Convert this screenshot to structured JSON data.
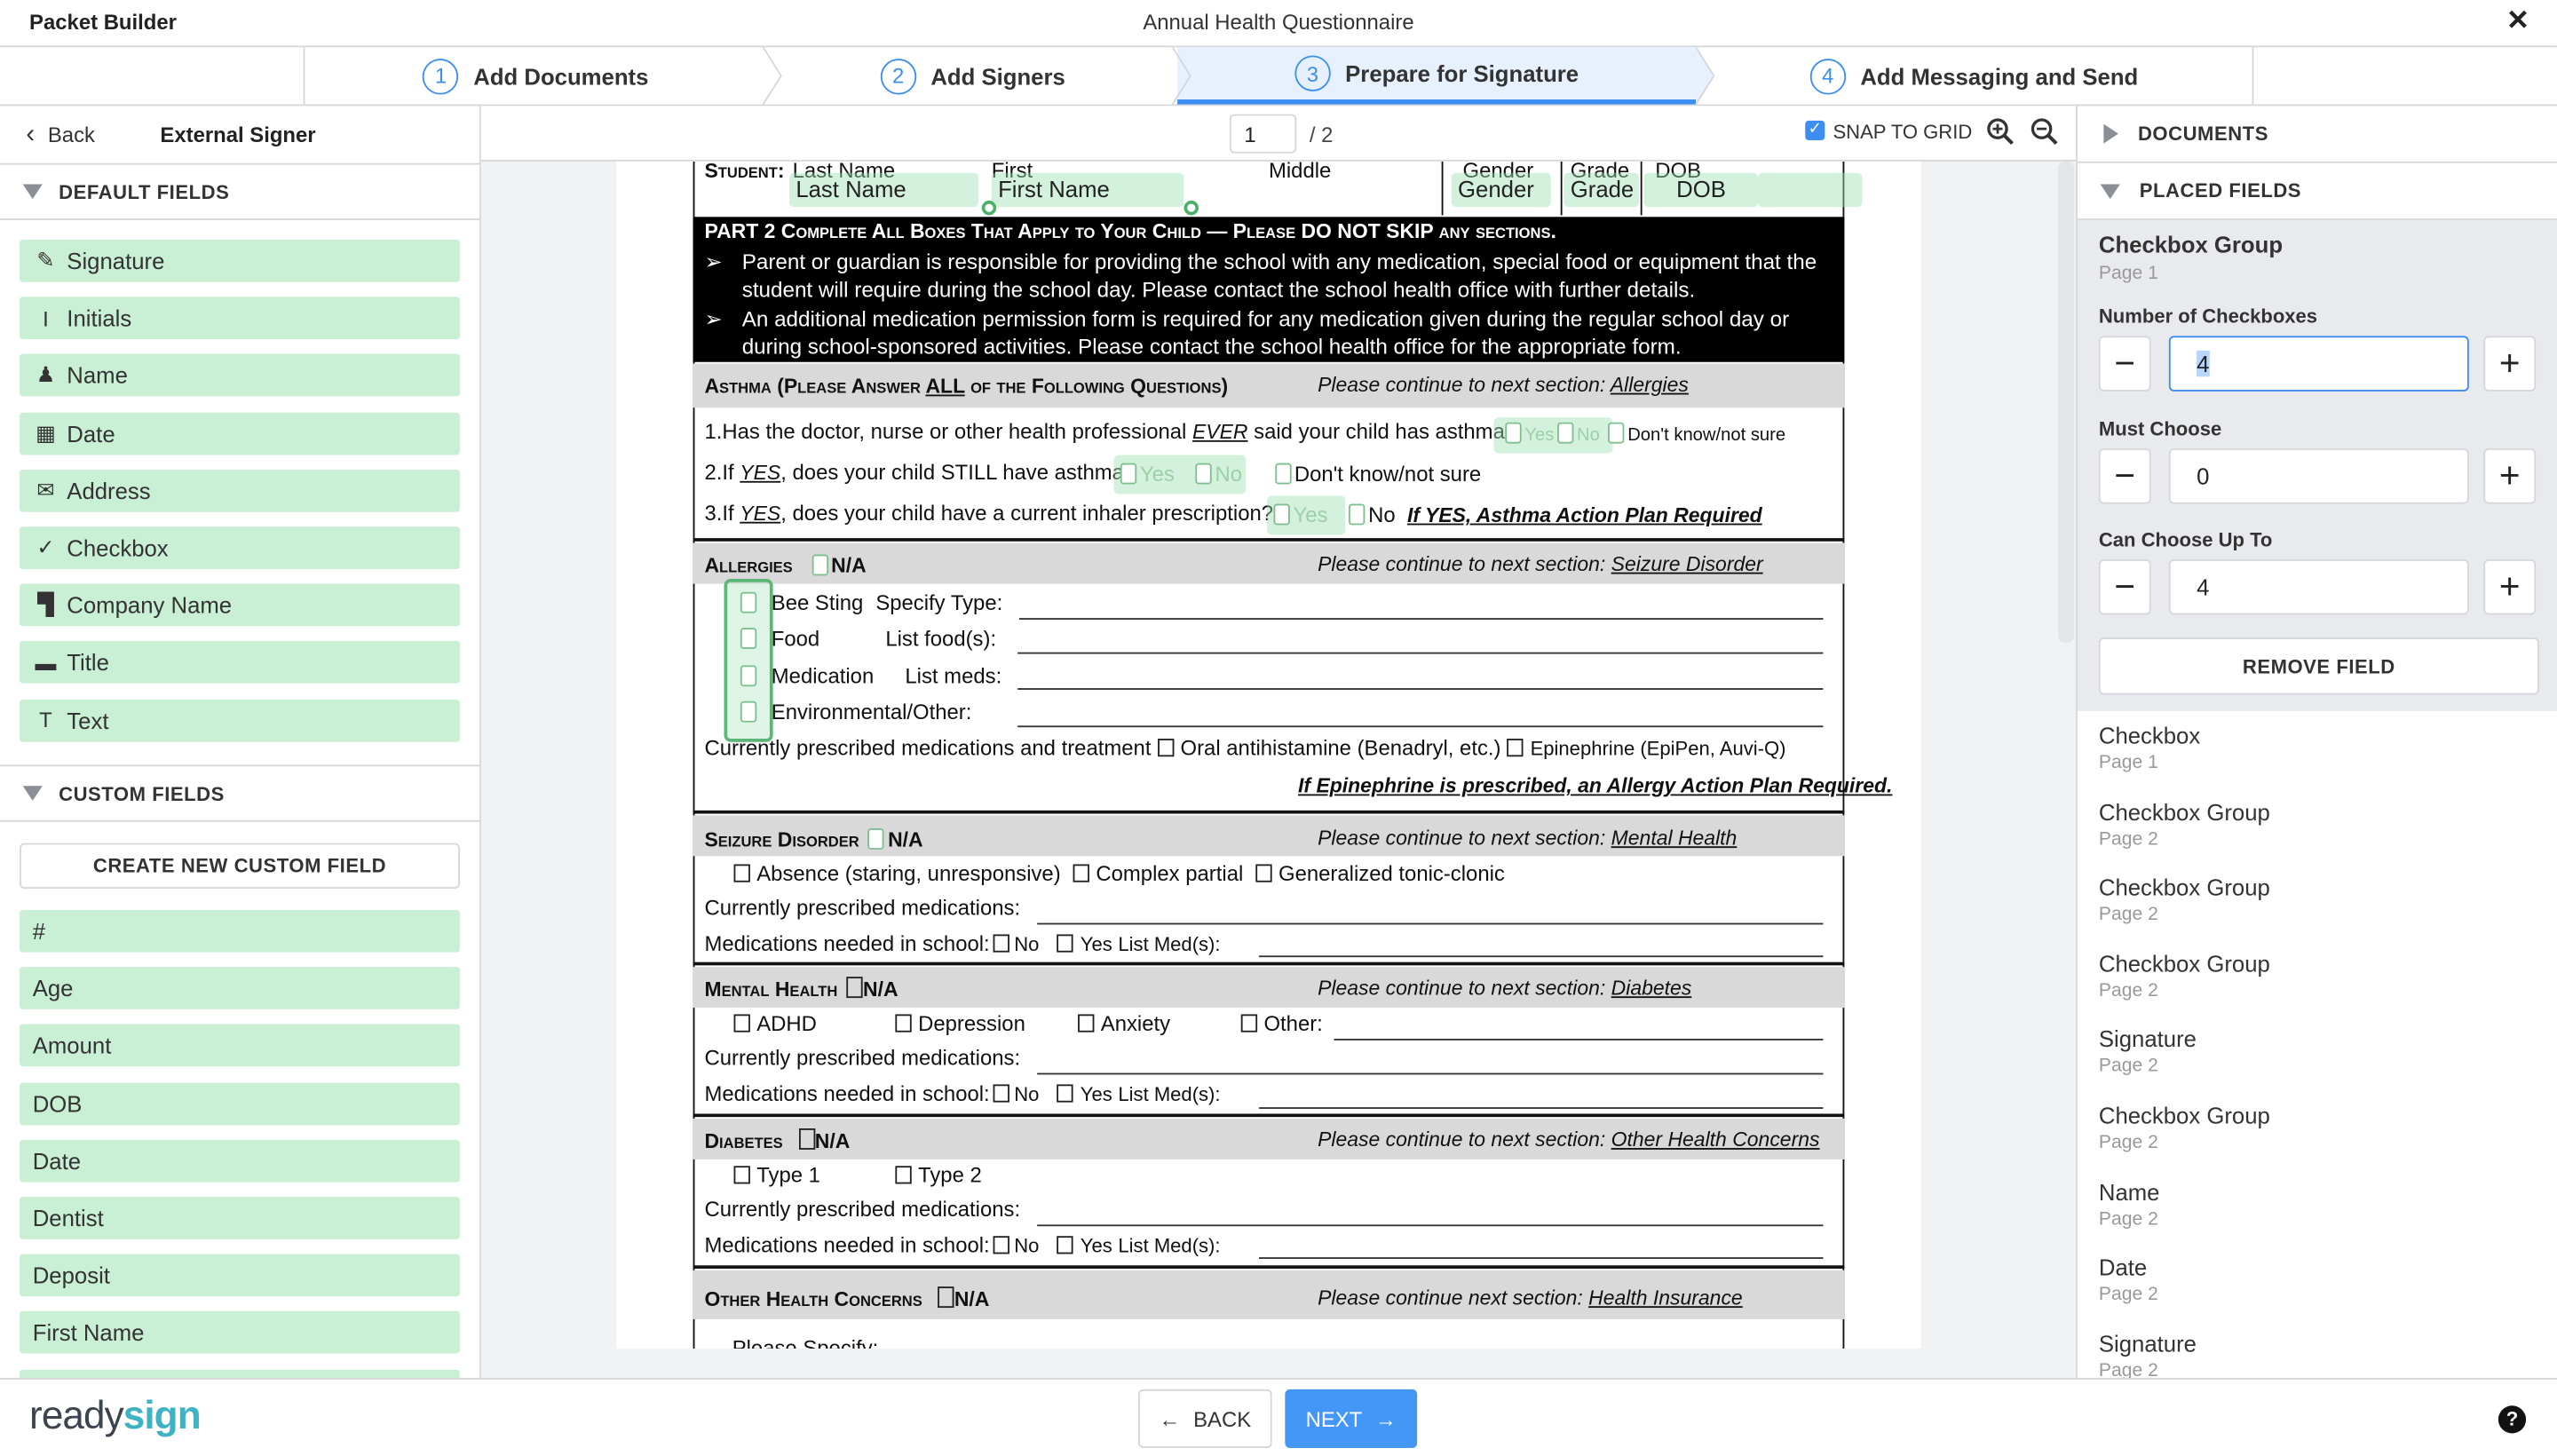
{
  "app": {
    "name": "Packet Builder",
    "doc_title": "Annual Health Questionnaire",
    "close_icon": "close-icon"
  },
  "steps": [
    {
      "num": "1",
      "label": "Add Documents"
    },
    {
      "num": "2",
      "label": "Add Signers"
    },
    {
      "num": "3",
      "label": "Prepare for Signature",
      "active": true
    },
    {
      "num": "4",
      "label": "Add Messaging and Send"
    }
  ],
  "left": {
    "back": "Back",
    "signer": "External Signer",
    "default_header": "DEFAULT FIELDS",
    "default_fields": [
      {
        "label": "Signature",
        "icon": "✎",
        "icon_name": "pen-icon"
      },
      {
        "label": "Initials",
        "icon": "I",
        "icon_name": "initials-icon"
      },
      {
        "label": "Name",
        "icon": "♟",
        "icon_name": "person-icon"
      },
      {
        "label": "Date",
        "icon": "▦",
        "icon_name": "calendar-icon"
      },
      {
        "label": "Address",
        "icon": "✉",
        "icon_name": "envelope-icon"
      },
      {
        "label": "Checkbox",
        "icon": "✓",
        "icon_name": "check-icon"
      },
      {
        "label": "Company Name",
        "icon": "▜",
        "icon_name": "building-icon"
      },
      {
        "label": "Title",
        "icon": "▬",
        "icon_name": "stamp-icon"
      },
      {
        "label": "Text",
        "icon": "T",
        "icon_name": "text-icon"
      }
    ],
    "custom_header": "CUSTOM FIELDS",
    "create_custom": "CREATE NEW CUSTOM FIELD",
    "custom_fields": [
      "#",
      "Age",
      "Amount",
      "DOB",
      "Date",
      "Dentist",
      "Deposit",
      "First Name",
      ""
    ],
    "field_color": "#c9efd5"
  },
  "toolbar": {
    "page": "1",
    "total": "/ 2",
    "snap": "SNAP TO GRID",
    "snap_checked": true
  },
  "doc": {
    "student": {
      "label": "Student:",
      "last": "Last Name",
      "first": "First",
      "middle": "Middle",
      "gender": "Gender",
      "grade": "Grade",
      "dob": "DOB"
    },
    "fields": {
      "last": "Last Name",
      "first": "First Name",
      "gender": "Gender",
      "grade": "Grade",
      "dob": "DOB"
    },
    "part2": {
      "title": "PART 2 Complete All Boxes That Apply to Your Child — Please DO NOT SKIP any sections.",
      "lines": [
        "Parent or guardian is responsible for providing the school with any medication, special food or equipment that the",
        "student will require during the school day. Please contact the school health office with further details.",
        "An additional medication permission form is required for any medication given during the regular school day or",
        "during school-sponsored activities. Please contact the school health office for the appropriate form."
      ]
    },
    "asthma": {
      "h1": "Asthma (Please Answer ",
      "h2": "ALL",
      "h3": " of the Following Questions)",
      "next": "Please continue to next section: ",
      "link": "Allergies",
      "q1a": "1.Has the doctor, nurse or other health professional ",
      "q1b": "EVER",
      "q1c": " said your child has asthma?",
      "q2a": "2.If ",
      "q2b": "YES",
      "q2c": ", does your child STILL have asthma?",
      "q3a": "3.If ",
      "q3b": "YES",
      "q3c": ", does your child have a current inhaler prescription?",
      "yes": "Yes",
      "no": "No",
      "dk": "Don't know/not sure",
      "plan": "If YES, Asthma Action Plan Required"
    },
    "allergies": {
      "title": "Allergies",
      "na": "N/A",
      "next": "Please continue to next section: ",
      "link": "Seizure Disorder",
      "rows": [
        {
          "a": "Bee Sting",
          "b": "Specify Type:"
        },
        {
          "a": "Food",
          "b": "List food(s):"
        },
        {
          "a": "Medication",
          "b": "List meds:"
        },
        {
          "a": "Environmental/Other:",
          "b": ""
        }
      ],
      "meds": "Currently prescribed medications and treatment",
      "oral": "Oral antihistamine (Benadryl, etc.)",
      "epi": "Epinephrine (EpiPen, Auvi-Q)",
      "note": "If Epinephrine is prescribed, an Allergy Action Plan Required."
    },
    "seizure": {
      "title": "Seizure Disorder",
      "na": "N/A",
      "next": "Please continue to next section: ",
      "link": "Mental Health",
      "o1": "Absence (staring, unresponsive)",
      "o2": "Complex partial",
      "o3": "Generalized tonic-clonic"
    },
    "mental": {
      "title": "Mental Health",
      "na": "N/A",
      "next": "Please continue to next section: ",
      "link": "Diabetes",
      "o1": "ADHD",
      "o2": "Depression",
      "o3": "Anxiety",
      "o4": "Other:"
    },
    "diabetes": {
      "title": "Diabetes",
      "na": "N/A",
      "next": "Please continue to next section: ",
      "link": "Other Health Concerns",
      "o1": "Type 1",
      "o2": "Type 2"
    },
    "other": {
      "title": "Other Health Concerns",
      "na": "N/A",
      "next": "Please continue next section: ",
      "link": "Health Insurance",
      "specify": "Please Specify:"
    },
    "common": {
      "curr": "Currently prescribed medications:",
      "need": "Medications needed in school:",
      "no": "No",
      "yes": "Yes",
      "list": "List Med(s):"
    }
  },
  "right": {
    "documents": "DOCUMENTS",
    "placed": "PLACED FIELDS",
    "selected": {
      "title": "Checkbox Group",
      "page": "Page 1",
      "num_label": "Number of Checkboxes",
      "num": "4",
      "must_label": "Must Choose",
      "must": "0",
      "upto_label": "Can Choose Up To",
      "upto": "4",
      "remove": "REMOVE FIELD"
    },
    "fields": [
      {
        "t": "Checkbox",
        "p": "Page 1"
      },
      {
        "t": "Checkbox Group",
        "p": "Page 2"
      },
      {
        "t": "Checkbox Group",
        "p": "Page 2"
      },
      {
        "t": "Checkbox Group",
        "p": "Page 2"
      },
      {
        "t": "Signature",
        "p": "Page 2"
      },
      {
        "t": "Checkbox Group",
        "p": "Page 2"
      },
      {
        "t": "Name",
        "p": "Page 2"
      },
      {
        "t": "Date",
        "p": "Page 2"
      },
      {
        "t": "Signature",
        "p": "Page 2"
      }
    ]
  },
  "footer": {
    "logo_a": "ready",
    "logo_b": "sign",
    "back": "BACK",
    "next": "NEXT",
    "accent": "#4597f5",
    "help_icon": "help-icon"
  }
}
